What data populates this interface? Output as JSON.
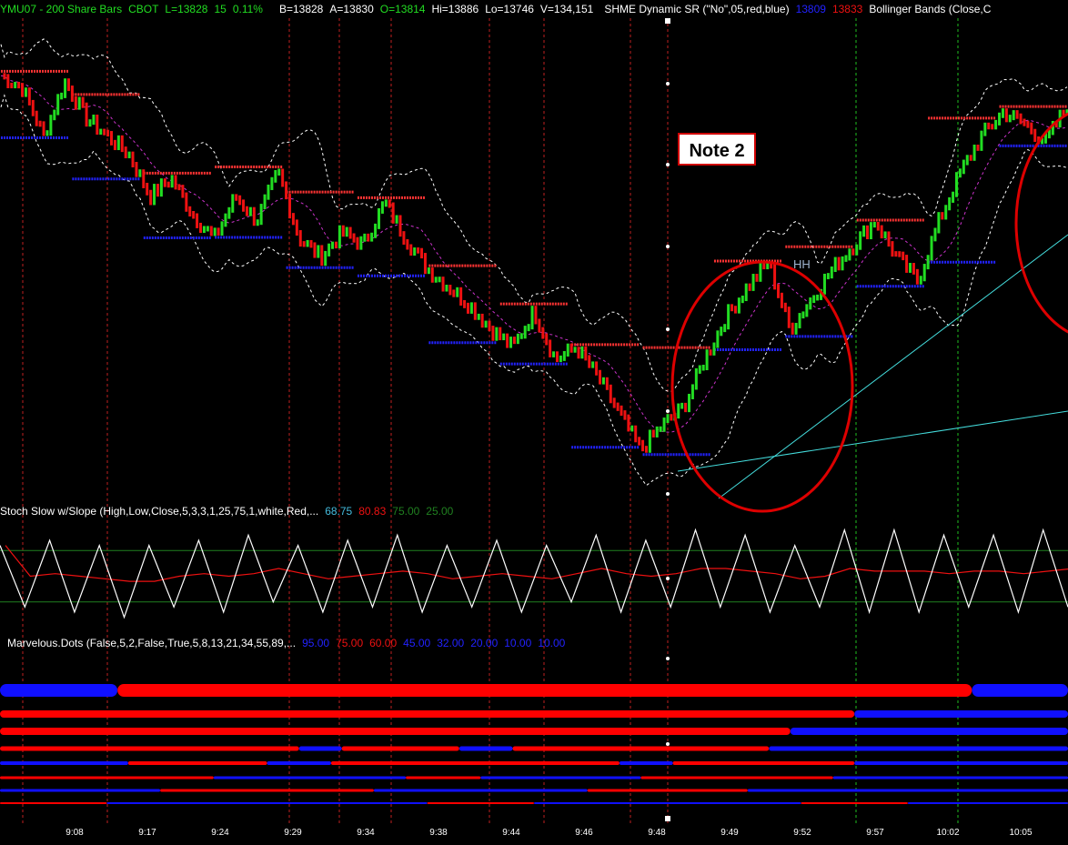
{
  "colors": {
    "up": "#22dd22",
    "down": "#ee1111",
    "resistance": "#ff3333",
    "support": "#2222ff",
    "band": "#ffffff",
    "mid_band": "#cc33cc",
    "trendline": "#44dddd",
    "grid_red": "#c02020",
    "grid_green": "#20c020",
    "stoch_k": "#ffffff",
    "stoch_d": "#ee1111",
    "stoch_level": "#208020",
    "annotation": "#dd0000"
  },
  "header": {
    "symbol": "YMU07 - 200 Share Bars",
    "exchange": "CBOT",
    "last": "L=13828",
    "change": "15",
    "change_pct": "0.11%",
    "bid": "B=13828",
    "ask": "A=13830",
    "open": "O=13814",
    "high": "Hi=13886",
    "low": "Lo=13746",
    "volume": "V=134,151",
    "study1": "SHME  Dynamic  SR (\"No\",05,red,blue)",
    "study1_val_support": "13809",
    "study1_val_resistance": "13833",
    "study2": "Bollinger Bands (Close,C"
  },
  "stoch": {
    "label": "Stoch Slow w/Slope (High,Low,Close,5,3,3,1,25,75,1,white,Red,...",
    "v1": "68.75",
    "v2": "80.83",
    "v3": "75.00",
    "v4": "25.00"
  },
  "dots": {
    "label": "Marvelous.Dots (False,5,2,False,True,5,8,13,21,34,55,89,...",
    "values": [
      "95.00",
      "75.00",
      "60.00",
      "45.00",
      "32.00",
      "20.00",
      "10.00",
      "10.00"
    ]
  },
  "annotations": {
    "note": "Note 2",
    "hh": "HH"
  },
  "chart_data": {
    "type": "candlestick",
    "instrument": "YMU07 - 200 Share Bars",
    "time_labels": [
      "9:08",
      "9:17",
      "9:24",
      "9:29",
      "9:34",
      "9:38",
      "9:44",
      "9:46",
      "9:48",
      "9:49",
      "9:52",
      "9:57",
      "10:02",
      "10:05"
    ],
    "price_path": [
      13872,
      13868,
      13852,
      13870,
      13858,
      13852,
      13846,
      13832,
      13838,
      13826,
      13818,
      13832,
      13824,
      13840,
      13818,
      13812,
      13820,
      13816,
      13830,
      13818,
      13808,
      13802,
      13796,
      13788,
      13782,
      13794,
      13778,
      13782,
      13772,
      13760,
      13748,
      13756,
      13762,
      13778,
      13792,
      13802,
      13810,
      13788,
      13798,
      13808,
      13816,
      13824,
      13812,
      13804,
      13824,
      13840,
      13852,
      13860,
      13856,
      13850,
      13862
    ],
    "stoch_k": [
      80,
      20,
      85,
      15,
      80,
      10,
      80,
      20,
      85,
      15,
      90,
      25,
      80,
      15,
      85,
      20,
      90,
      15,
      80,
      20,
      85,
      15,
      80,
      25,
      90,
      15,
      85,
      20,
      95,
      20,
      90,
      15,
      80,
      20,
      95,
      15,
      95,
      15,
      90,
      20,
      90,
      15,
      95,
      20
    ],
    "stoch_levels": [
      75,
      25
    ],
    "dots_rows": [
      [
        [
          "blue",
          0.11
        ],
        [
          "red",
          0.91
        ],
        [
          "blue",
          1
        ]
      ],
      [
        [
          "red",
          0.8
        ],
        [
          "blue",
          1
        ]
      ],
      [
        [
          "red",
          0.74
        ],
        [
          "blue",
          1
        ]
      ],
      [
        [
          "red",
          0.28
        ],
        [
          "blue",
          0.32
        ],
        [
          "red",
          0.43
        ],
        [
          "blue",
          0.48
        ],
        [
          "red",
          0.72
        ],
        [
          "blue",
          1
        ]
      ],
      [
        [
          "blue",
          0.12
        ],
        [
          "red",
          0.25
        ],
        [
          "blue",
          0.31
        ],
        [
          "red",
          0.58
        ],
        [
          "blue",
          0.63
        ],
        [
          "red",
          0.8
        ],
        [
          "blue",
          1
        ]
      ],
      [
        [
          "red",
          0.2
        ],
        [
          "blue",
          0.38
        ],
        [
          "red",
          0.45
        ],
        [
          "blue",
          0.6
        ],
        [
          "red",
          0.78
        ],
        [
          "blue",
          1
        ]
      ],
      [
        [
          "blue",
          0.15
        ],
        [
          "red",
          0.35
        ],
        [
          "blue",
          0.55
        ],
        [
          "red",
          0.7
        ],
        [
          "blue",
          1
        ]
      ],
      [
        [
          "red",
          0.1
        ],
        [
          "blue",
          0.4
        ],
        [
          "red",
          0.5
        ],
        [
          "blue",
          0.75
        ],
        [
          "red",
          0.85
        ],
        [
          "blue",
          1
        ]
      ]
    ]
  }
}
